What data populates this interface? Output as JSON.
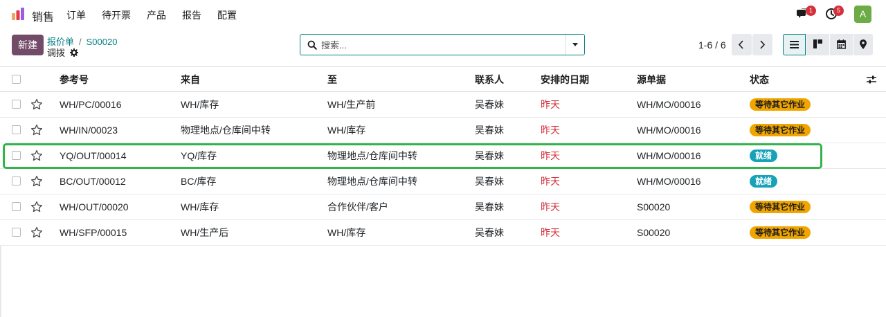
{
  "app": {
    "name": "销售",
    "accent": "#714b67",
    "link_color": "#017e84"
  },
  "nav": {
    "items": [
      "订单",
      "待开票",
      "产品",
      "报告",
      "配置"
    ]
  },
  "systray": {
    "messages_count": "1",
    "activity_count": "5",
    "avatar_letter": "A"
  },
  "control": {
    "new_label": "新建",
    "breadcrumb": [
      "报价单",
      "S00020"
    ],
    "breadcrumb_sep": "/",
    "subtitle": "调拨",
    "search_placeholder": "搜索...",
    "pager": "1-6 / 6"
  },
  "views": [
    "list-view",
    "kanban-view",
    "calendar-view",
    "map-view"
  ],
  "table": {
    "headers": {
      "reference": "参考号",
      "from": "来自",
      "to": "至",
      "contact": "联系人",
      "scheduled": "安排的日期",
      "source": "源单据",
      "status": "状态"
    },
    "rows": [
      {
        "reference": "WH/PC/00016",
        "from": "WH/库存",
        "to": "WH/生产前",
        "contact": "吴春妹",
        "scheduled": "昨天",
        "source": "WH/MO/00016",
        "status": "等待其它作业",
        "status_kind": "warn"
      },
      {
        "reference": "WH/IN/00023",
        "from": "物理地点/仓库间中转",
        "to": "WH/库存",
        "contact": "吴春妹",
        "scheduled": "昨天",
        "source": "WH/MO/00016",
        "status": "等待其它作业",
        "status_kind": "warn"
      },
      {
        "reference": "YQ/OUT/00014",
        "from": "YQ/库存",
        "to": "物理地点/仓库间中转",
        "contact": "吴春妹",
        "scheduled": "昨天",
        "source": "WH/MO/00016",
        "status": "就绪",
        "status_kind": "info"
      },
      {
        "reference": "BC/OUT/00012",
        "from": "BC/库存",
        "to": "物理地点/仓库间中转",
        "contact": "吴春妹",
        "scheduled": "昨天",
        "source": "WH/MO/00016",
        "status": "就绪",
        "status_kind": "info"
      },
      {
        "reference": "WH/OUT/00020",
        "from": "WH/库存",
        "to": "合作伙伴/客户",
        "contact": "吴春妹",
        "scheduled": "昨天",
        "source": "S00020",
        "status": "等待其它作业",
        "status_kind": "warn"
      },
      {
        "reference": "WH/SFP/00015",
        "from": "WH/生产后",
        "to": "WH/库存",
        "contact": "吴春妹",
        "scheduled": "昨天",
        "source": "S00020",
        "status": "等待其它作业",
        "status_kind": "warn"
      }
    ]
  },
  "colors": {
    "danger": "#d4303b",
    "warn": "#f0a500",
    "info": "#17a2b8",
    "highlight": "#34b34a"
  }
}
